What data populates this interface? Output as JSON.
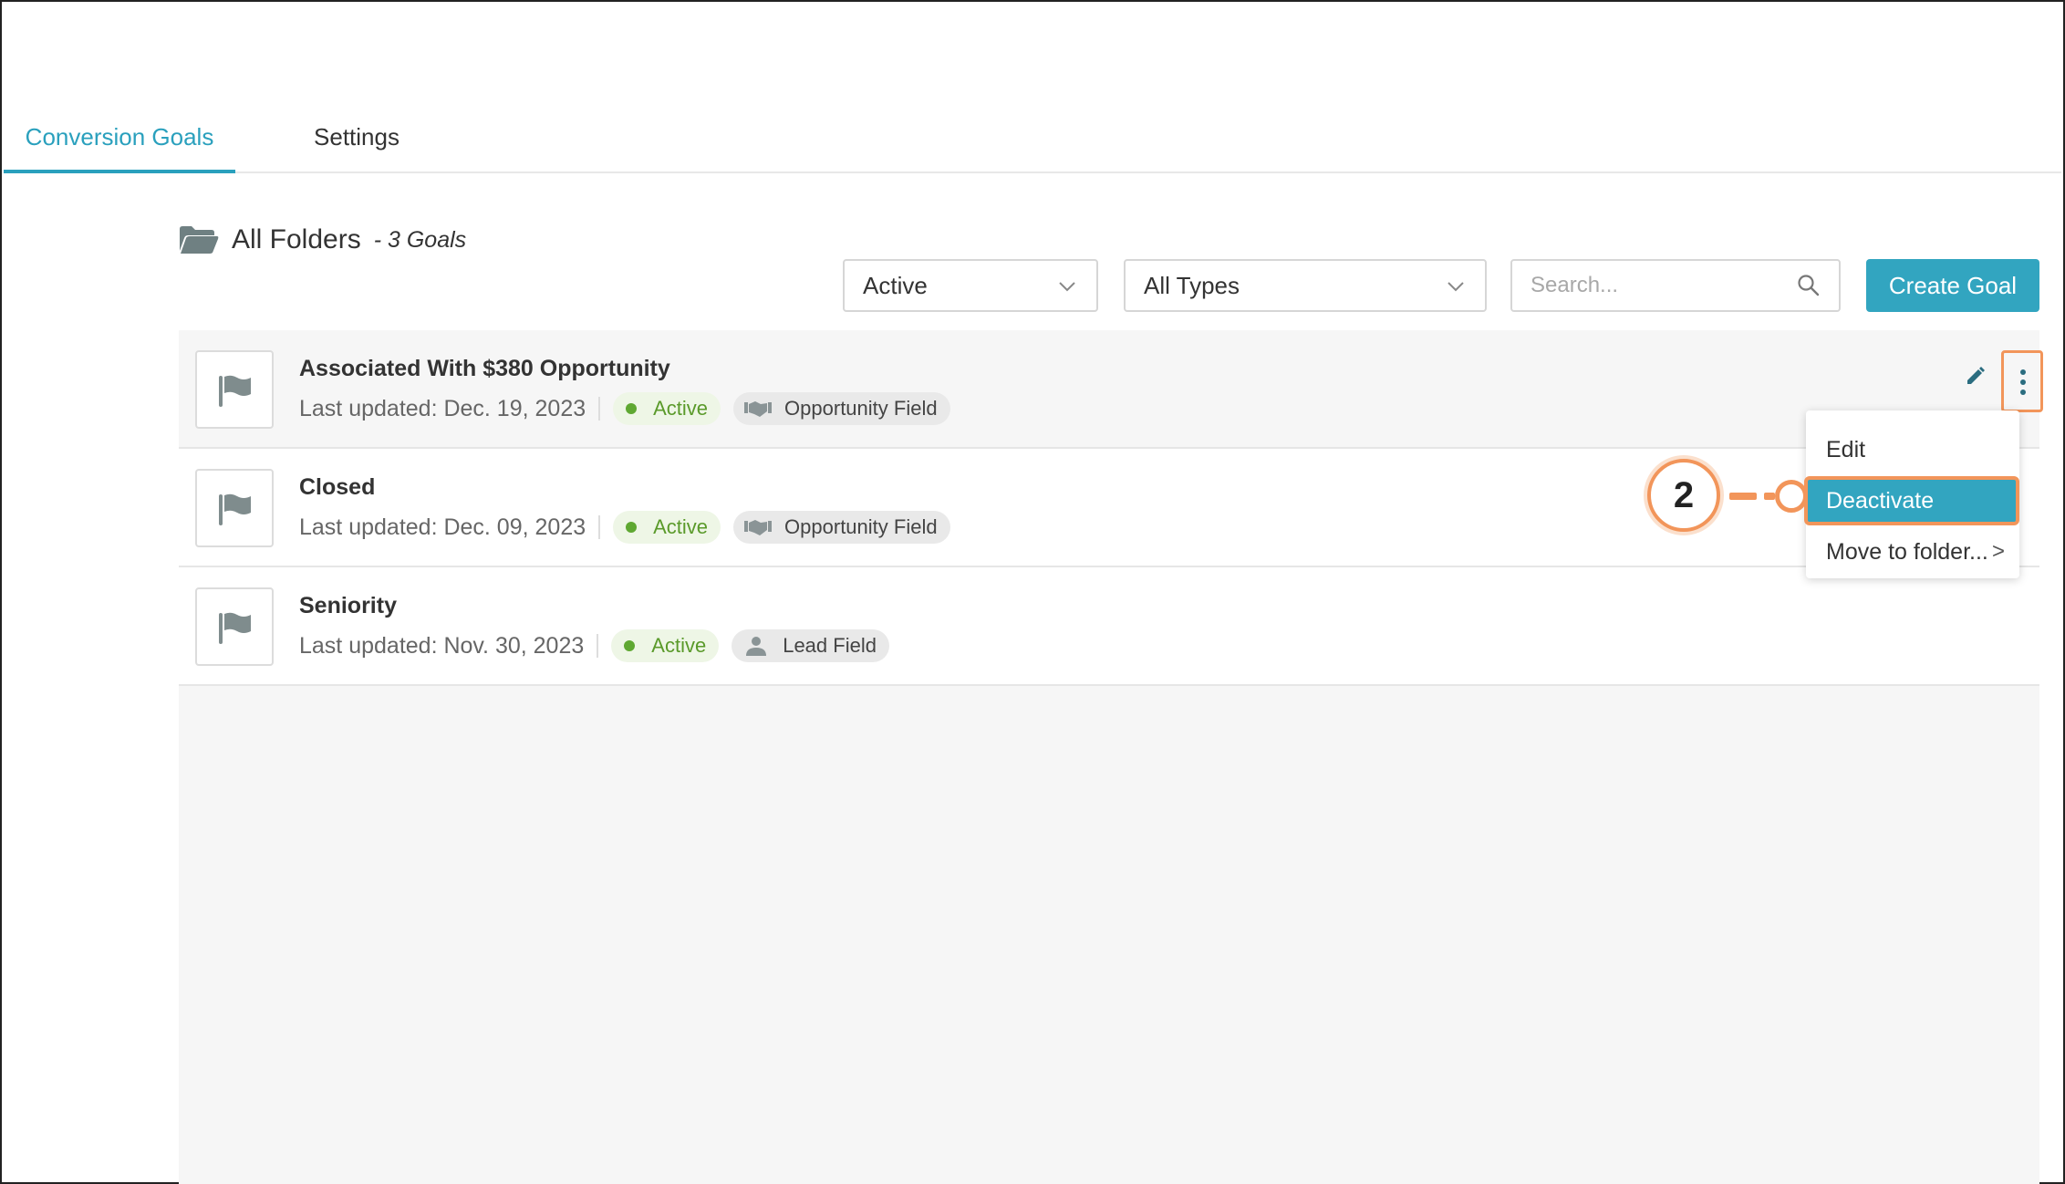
{
  "tabs": [
    {
      "label": "Conversion Goals",
      "active": true
    },
    {
      "label": "Settings",
      "active": false
    }
  ],
  "folder": {
    "title": "All Folders",
    "count": "- 3 Goals",
    "icon": "folder-open-icon"
  },
  "filters": {
    "status": {
      "selected": "Active",
      "icon": "chevron-down-icon"
    },
    "type": {
      "selected": "All Types",
      "icon": "chevron-down-icon"
    },
    "search": {
      "placeholder": "Search...",
      "icon": "search-icon"
    },
    "create_label": "Create Goal"
  },
  "goals": [
    {
      "name": "Associated With $380 Opportunity",
      "updated": "Last updated: Dec. 19, 2023",
      "status": "Active",
      "type": "Opportunity Field",
      "type_icon": "handshake-icon"
    },
    {
      "name": "Closed",
      "updated": "Last updated: Dec. 09, 2023",
      "status": "Active",
      "type": "Opportunity Field",
      "type_icon": "handshake-icon"
    },
    {
      "name": "Seniority",
      "updated": "Last updated: Nov. 30, 2023",
      "status": "Active",
      "type": "Lead Field",
      "type_icon": "person-icon"
    }
  ],
  "menu": {
    "items": [
      {
        "label": "Edit"
      },
      {
        "label": "Deactivate",
        "highlighted": true
      },
      {
        "label": "Move to folder...",
        "submenu_arrow": ">"
      }
    ]
  },
  "callout": {
    "number": "2"
  },
  "colors": {
    "accent": "#32a5c0",
    "tab_active": "#2aa0bd",
    "callout": "#f2955a",
    "status_green": "#5fa832"
  }
}
